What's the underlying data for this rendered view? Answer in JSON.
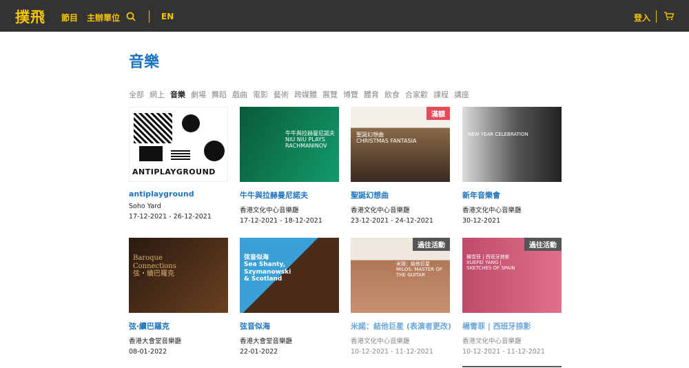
{
  "header": {
    "logo": "撲飛",
    "nav": [
      "節目",
      "主辦單位"
    ],
    "lang": "EN",
    "login": "登入"
  },
  "page_title": "音樂",
  "tabs": [
    "全部",
    "網上",
    "音樂",
    "劇場",
    "舞蹈",
    "戲曲",
    "電影",
    "藝術",
    "跨媒體",
    "展覽",
    "博覽",
    "體育",
    "飲食",
    "合家歡",
    "課程",
    "講座"
  ],
  "active_tab_index": 2,
  "events": [
    {
      "title": "antiplayground",
      "venue": "Soho Yard",
      "date": "17-12-2021 - 26-12-2021",
      "badge": "",
      "past": false,
      "poster_text": "ANTIPLAYGROUND"
    },
    {
      "title": "牛牛與拉赫曼尼諾夫",
      "venue": "香港文化中心音樂廳",
      "date": "17-12-2021 - 18-12-2021",
      "badge": "",
      "past": false,
      "poster_text": "牛牛與拉赫曼尼諾夫\nNIU NIU PLAYS\nRACHMANINOV"
    },
    {
      "title": "聖誕幻想曲",
      "venue": "香港文化中心音樂廳",
      "date": "23-12-2021 - 24-12-2021",
      "badge": "滿額",
      "past": false,
      "poster_text": "聖誕幻想曲\nCHRISTMAS FANTASIA"
    },
    {
      "title": "新年音樂會",
      "venue": "香港文化中心音樂廳",
      "date": "30-12-2021",
      "badge": "",
      "past": false,
      "poster_text": "NEW YEAR CELEBRATION"
    },
    {
      "title": "弦‧續巴羅克",
      "venue": "香港大會堂音樂廳",
      "date": "08-01-2022",
      "badge": "",
      "past": false,
      "poster_text": "Baroque\nConnections\n弦‧續巴羅克"
    },
    {
      "title": "弦音似海",
      "venue": "香港大會堂音樂廳",
      "date": "22-01-2022",
      "badge": "",
      "past": false,
      "poster_text": "弦音似海\nSea Shanty,\nSzymanowski\n& Scotland"
    },
    {
      "title": "米諾：結他巨星 (表演者更改)",
      "venue": "香港文化中心音樂廳",
      "date": "10-12-2021 - 11-12-2021",
      "badge": "過往活動",
      "past": true,
      "poster_text": "米諾：結他巨星\nMILOS: MASTER OF\nTHE GUITAR"
    },
    {
      "title": "楊雪菲 | 西班牙掠影",
      "venue": "香港文化中心音樂廳",
      "date": "10-12-2021 - 11-12-2021",
      "badge": "過往活動",
      "past": true,
      "poster_text": "楊雪菲 | 西班牙掠影\nXUEFEI YANG |\nSKETCHES OF SPAIN"
    }
  ],
  "colors": {
    "accent": "#f5c400",
    "link": "#1e73be",
    "topbar": "#333333"
  }
}
